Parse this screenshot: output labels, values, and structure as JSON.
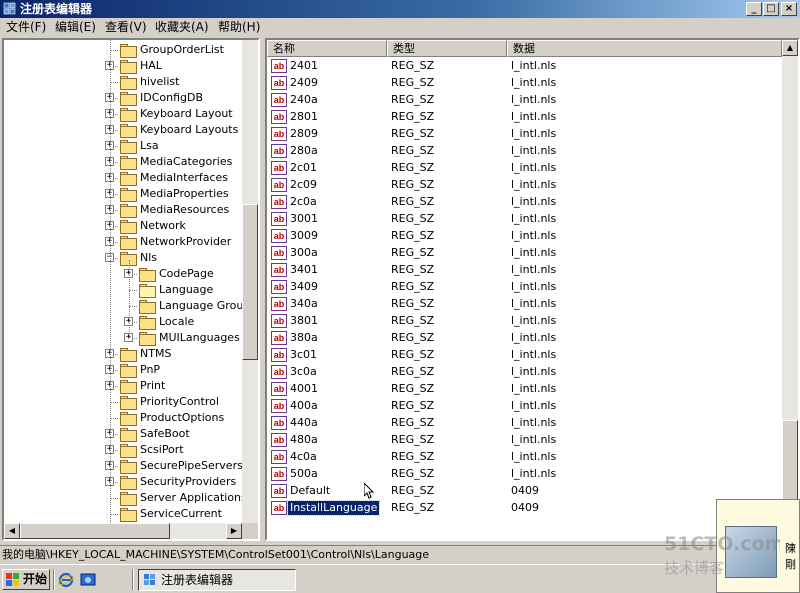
{
  "window": {
    "title": "注册表编辑器",
    "controls": {
      "minimize": "_",
      "maximize": "□",
      "close": "×"
    }
  },
  "menu": [
    {
      "label": "文件(F)"
    },
    {
      "label": "编辑(E)"
    },
    {
      "label": "查看(V)"
    },
    {
      "label": "收藏夹(A)"
    },
    {
      "label": "帮助(H)"
    }
  ],
  "tree": [
    {
      "label": "GroupOrderList",
      "depth": 0,
      "expander": "none"
    },
    {
      "label": "HAL",
      "depth": 0,
      "expander": "plus"
    },
    {
      "label": "hivelist",
      "depth": 0,
      "expander": "none"
    },
    {
      "label": "IDConfigDB",
      "depth": 0,
      "expander": "plus"
    },
    {
      "label": "Keyboard Layout",
      "depth": 0,
      "expander": "plus"
    },
    {
      "label": "Keyboard Layouts",
      "depth": 0,
      "expander": "plus"
    },
    {
      "label": "Lsa",
      "depth": 0,
      "expander": "plus"
    },
    {
      "label": "MediaCategories",
      "depth": 0,
      "expander": "plus"
    },
    {
      "label": "MediaInterfaces",
      "depth": 0,
      "expander": "plus"
    },
    {
      "label": "MediaProperties",
      "depth": 0,
      "expander": "plus"
    },
    {
      "label": "MediaResources",
      "depth": 0,
      "expander": "plus"
    },
    {
      "label": "Network",
      "depth": 0,
      "expander": "plus"
    },
    {
      "label": "NetworkProvider",
      "depth": 0,
      "expander": "plus"
    },
    {
      "label": "Nls",
      "depth": 0,
      "expander": "minus"
    },
    {
      "label": "CodePage",
      "depth": 1,
      "expander": "plus"
    },
    {
      "label": "Language",
      "depth": 1,
      "expander": "none",
      "open": true
    },
    {
      "label": "Language Groups",
      "depth": 1,
      "expander": "none"
    },
    {
      "label": "Locale",
      "depth": 1,
      "expander": "plus"
    },
    {
      "label": "MUILanguages",
      "depth": 1,
      "expander": "plus"
    },
    {
      "label": "NTMS",
      "depth": 0,
      "expander": "plus"
    },
    {
      "label": "PnP",
      "depth": 0,
      "expander": "plus"
    },
    {
      "label": "Print",
      "depth": 0,
      "expander": "plus"
    },
    {
      "label": "PriorityControl",
      "depth": 0,
      "expander": "none"
    },
    {
      "label": "ProductOptions",
      "depth": 0,
      "expander": "none"
    },
    {
      "label": "SafeBoot",
      "depth": 0,
      "expander": "plus"
    },
    {
      "label": "ScsiPort",
      "depth": 0,
      "expander": "plus"
    },
    {
      "label": "SecurePipeServers",
      "depth": 0,
      "expander": "plus"
    },
    {
      "label": "SecurityProviders",
      "depth": 0,
      "expander": "plus"
    },
    {
      "label": "Server Applications",
      "depth": 0,
      "expander": "none"
    },
    {
      "label": "ServiceCurrent",
      "depth": 0,
      "expander": "none"
    }
  ],
  "columns": {
    "name": "名称",
    "type": "类型",
    "data": "数据"
  },
  "values": [
    {
      "name": "2401",
      "type": "REG_SZ",
      "data": "l_intl.nls"
    },
    {
      "name": "2409",
      "type": "REG_SZ",
      "data": "l_intl.nls"
    },
    {
      "name": "240a",
      "type": "REG_SZ",
      "data": "l_intl.nls"
    },
    {
      "name": "2801",
      "type": "REG_SZ",
      "data": "l_intl.nls"
    },
    {
      "name": "2809",
      "type": "REG_SZ",
      "data": "l_intl.nls"
    },
    {
      "name": "280a",
      "type": "REG_SZ",
      "data": "l_intl.nls"
    },
    {
      "name": "2c01",
      "type": "REG_SZ",
      "data": "l_intl.nls"
    },
    {
      "name": "2c09",
      "type": "REG_SZ",
      "data": "l_intl.nls"
    },
    {
      "name": "2c0a",
      "type": "REG_SZ",
      "data": "l_intl.nls"
    },
    {
      "name": "3001",
      "type": "REG_SZ",
      "data": "l_intl.nls"
    },
    {
      "name": "3009",
      "type": "REG_SZ",
      "data": "l_intl.nls"
    },
    {
      "name": "300a",
      "type": "REG_SZ",
      "data": "l_intl.nls"
    },
    {
      "name": "3401",
      "type": "REG_SZ",
      "data": "l_intl.nls"
    },
    {
      "name": "3409",
      "type": "REG_SZ",
      "data": "l_intl.nls"
    },
    {
      "name": "340a",
      "type": "REG_SZ",
      "data": "l_intl.nls"
    },
    {
      "name": "3801",
      "type": "REG_SZ",
      "data": "l_intl.nls"
    },
    {
      "name": "380a",
      "type": "REG_SZ",
      "data": "l_intl.nls"
    },
    {
      "name": "3c01",
      "type": "REG_SZ",
      "data": "l_intl.nls"
    },
    {
      "name": "3c0a",
      "type": "REG_SZ",
      "data": "l_intl.nls"
    },
    {
      "name": "4001",
      "type": "REG_SZ",
      "data": "l_intl.nls"
    },
    {
      "name": "400a",
      "type": "REG_SZ",
      "data": "l_intl.nls"
    },
    {
      "name": "440a",
      "type": "REG_SZ",
      "data": "l_intl.nls"
    },
    {
      "name": "480a",
      "type": "REG_SZ",
      "data": "l_intl.nls"
    },
    {
      "name": "4c0a",
      "type": "REG_SZ",
      "data": "l_intl.nls"
    },
    {
      "name": "500a",
      "type": "REG_SZ",
      "data": "l_intl.nls"
    },
    {
      "name": "Default",
      "type": "REG_SZ",
      "data": "0409"
    },
    {
      "name": "InstallLanguage",
      "type": "REG_SZ",
      "data": "0409",
      "selected": true
    }
  ],
  "icons": {
    "value_icon": "ab",
    "start_icon": "windows-flag-icon"
  },
  "status_bar": {
    "path": "我的电脑\\HKEY_LOCAL_MACHINE\\SYSTEM\\ControlSet001\\Control\\Nls\\Language"
  },
  "taskbar": {
    "start_label": "开始",
    "task_label": "注册表编辑器"
  },
  "notification": {
    "line1": "陳",
    "line2": "剛"
  },
  "watermark": {
    "line1": "51CTO.com",
    "line2": "技术博客"
  },
  "colors": {
    "titlebar": "#0a246a",
    "face": "#d4d0c8",
    "selection": "#0a246a",
    "folder": "#ffe08a"
  }
}
